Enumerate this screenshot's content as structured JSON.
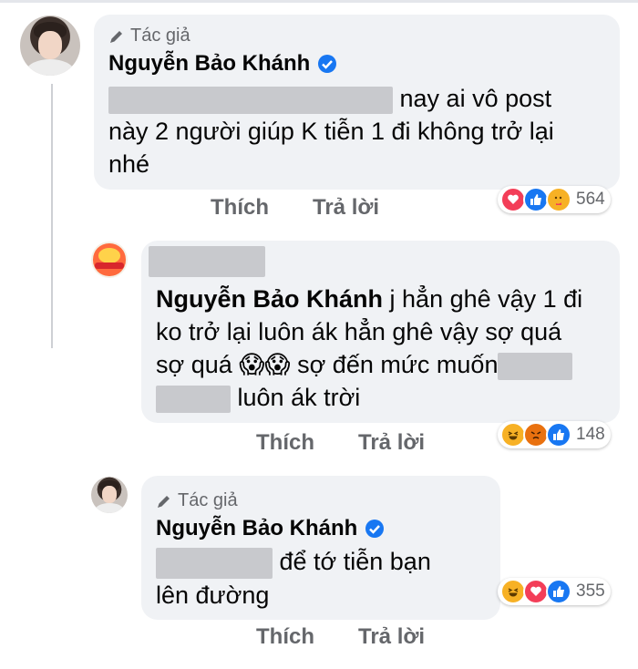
{
  "comment1": {
    "badge": "Tác giả",
    "author": "Nguyễn Bảo Khánh",
    "text_line1": "nay ai vô post",
    "text_line2": "này 2 người giúp K tiễn 1 đi không trở lại",
    "text_line3": "nhé",
    "like_label": "Thích",
    "reply_label": "Trả lời",
    "reaction_count": "564",
    "reaction_icons": [
      "heart-icon",
      "like-icon",
      "care-icon"
    ]
  },
  "comment2": {
    "tag": "Nguyễn Bảo Khánh",
    "text_a": "j hẳn ghê vậy 1 đi",
    "text_b": "ko trở lại luôn ák hẳn ghê vậy sợ quá",
    "text_c1": "sợ quá",
    "emoji": "😱😱",
    "text_c2": "sợ đến mức muốn",
    "text_d": "luôn ák trời",
    "like_label": "Thích",
    "reply_label": "Trả lời",
    "reaction_count": "148",
    "reaction_icons": [
      "haha-icon",
      "angry-icon",
      "like-icon"
    ]
  },
  "comment3": {
    "badge": "Tác giả",
    "author": "Nguyễn Bảo Khánh",
    "text_line1": "để tớ tiễn bạn",
    "text_line2": "lên đường",
    "like_label": "Thích",
    "reply_label": "Trả lời",
    "reaction_count": "355",
    "reaction_icons": [
      "haha-icon",
      "heart-icon",
      "like-icon"
    ]
  }
}
